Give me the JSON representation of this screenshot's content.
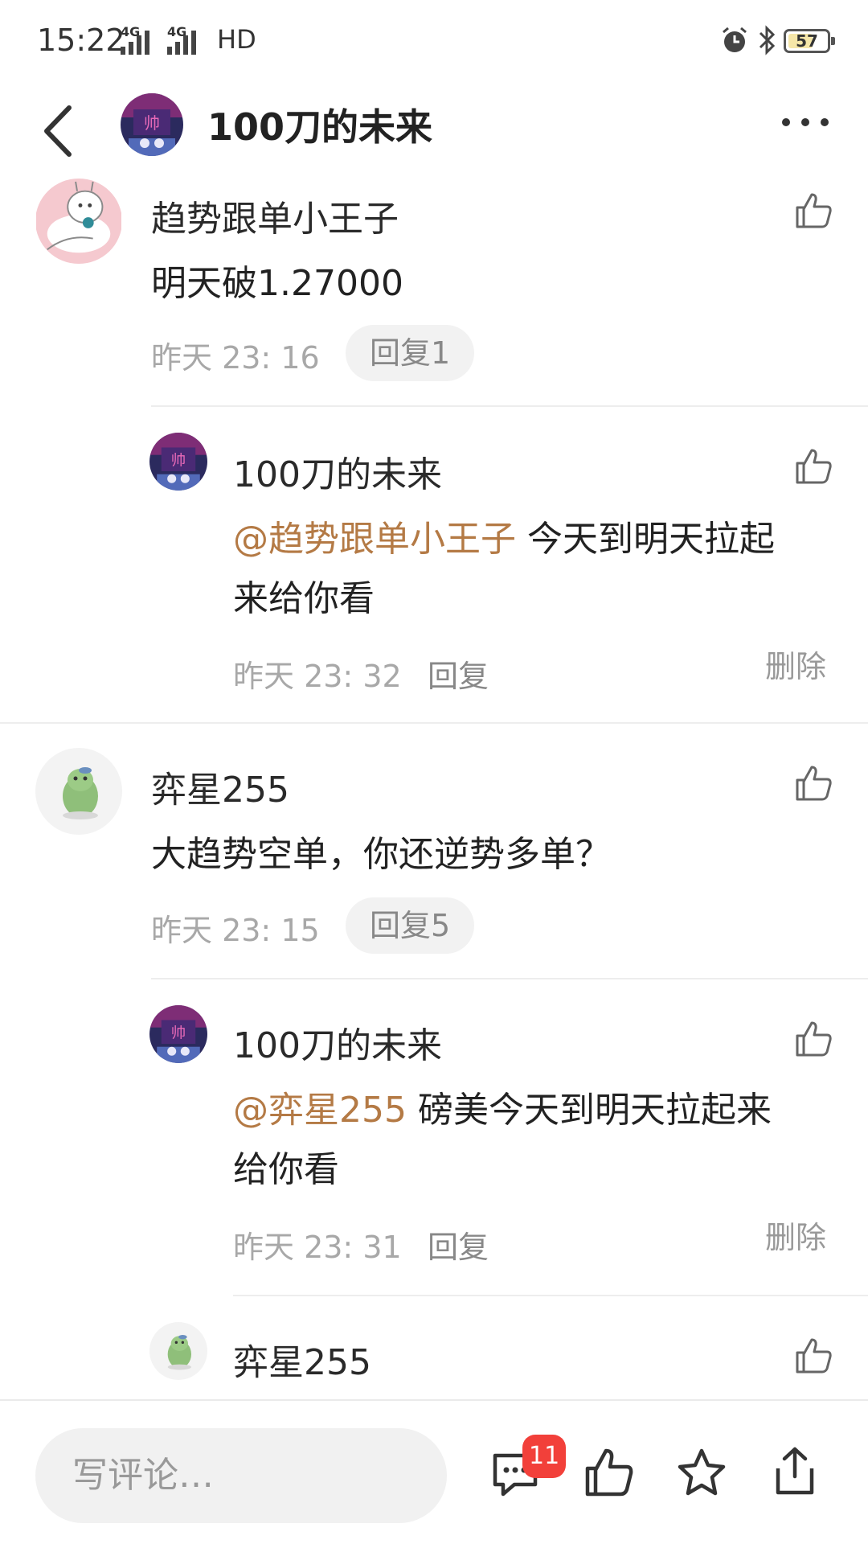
{
  "status_bar": {
    "time": "15:22",
    "network1": "4G",
    "network2": "4G",
    "hd": "HD",
    "battery": "57"
  },
  "header": {
    "title": "100刀的未来",
    "avatar_glyph": "帅"
  },
  "comments": [
    {
      "username": "趋势跟单小王子",
      "text": "明天破1.27000",
      "time": "昨天 23: 16",
      "reply_count_label": "回复1",
      "replies": [
        {
          "username": "100刀的未来",
          "mention": "@趋势跟单小王子",
          "text_line1": " 今天到明天拉起",
          "text_line2": "来给你看",
          "time": "昨天 23: 32",
          "reply_label": "回复",
          "delete_label": "删除"
        }
      ]
    },
    {
      "username": "弈星255",
      "text": "大趋势空单，你还逆势多单？",
      "time": "昨天 23: 15",
      "reply_count_label": "回复5",
      "replies": [
        {
          "username": "100刀的未来",
          "mention": "@弈星255",
          "text_line1": " 磅美今天到明天拉起来",
          "text_line2": "给你看",
          "time": "昨天 23: 31",
          "reply_label": "回复",
          "delete_label": "删除"
        },
        {
          "username": "弈星255"
        }
      ]
    }
  ],
  "bottom_bar": {
    "input_placeholder": "写评论…",
    "comment_badge": "11"
  },
  "icons": {
    "back": "back-arrow-icon",
    "more": "more-dots-icon",
    "like": "thumbs-up-icon",
    "comments": "comment-bubble-icon",
    "favorite": "star-icon",
    "share": "share-icon"
  },
  "colors": {
    "mention": "#b47a45",
    "badge": "#f2403a",
    "secondary_text": "#a8a8a8"
  }
}
